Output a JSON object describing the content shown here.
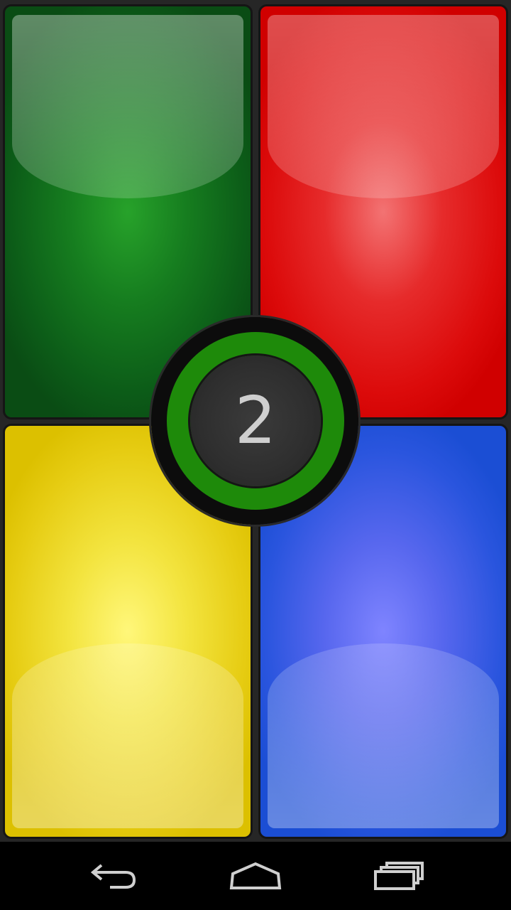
{
  "game": {
    "round_number": "2",
    "pads": [
      {
        "color": "green",
        "hex": "#167d1f"
      },
      {
        "color": "red",
        "hex": "#e62b2b"
      },
      {
        "color": "yellow",
        "hex": "#f3e43f"
      },
      {
        "color": "blue",
        "hex": "#2a55de"
      }
    ],
    "hub_ring_color": "#1e8a0a"
  },
  "navbar": {
    "back_icon": "back-icon",
    "home_icon": "home-icon",
    "recent_icon": "recent-apps-icon"
  }
}
